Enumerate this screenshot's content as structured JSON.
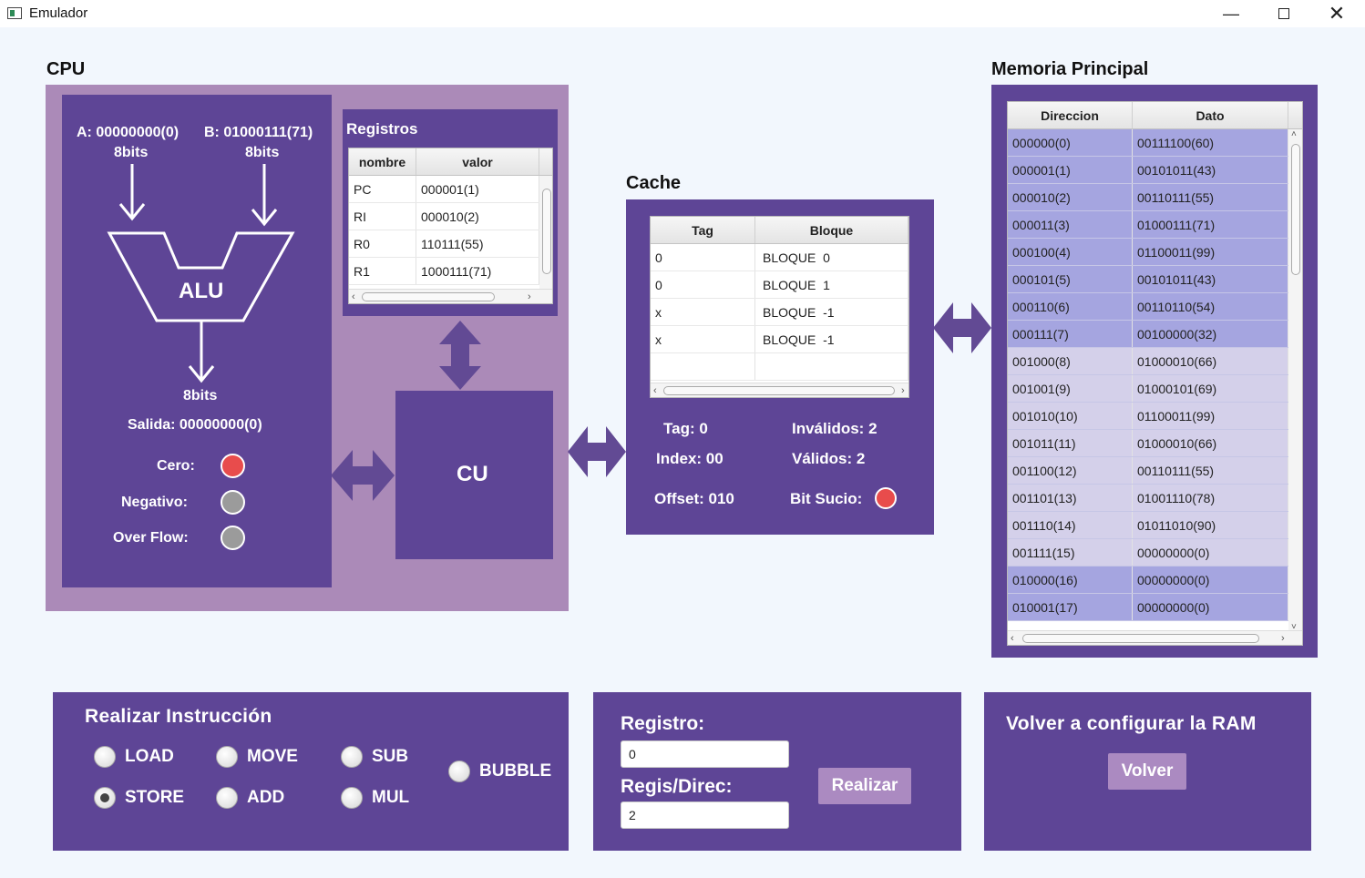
{
  "window": {
    "title": "Emulador"
  },
  "cpu": {
    "title": "CPU",
    "alu": {
      "a_label": "A: 00000000(0)",
      "a_bits": "8bits",
      "b_label": "B: 01000111(71)",
      "b_bits": "8bits",
      "alu_label": "ALU",
      "out_bits": "8bits",
      "salida": "Salida: 00000000(0)",
      "flags": [
        {
          "label": "Cero:",
          "color": "#e84c4c"
        },
        {
          "label": "Negativo:",
          "color": "#9b9b9b"
        },
        {
          "label": "Over Flow:",
          "color": "#9b9b9b"
        }
      ]
    },
    "registros": {
      "title": "Registros",
      "columns": [
        "nombre",
        "valor"
      ],
      "rows": [
        [
          "PC",
          "000001(1)"
        ],
        [
          "RI",
          "000010(2)"
        ],
        [
          "R0",
          "110111(55)"
        ],
        [
          "R1",
          "1000111(71)"
        ]
      ]
    },
    "cu_label": "CU"
  },
  "cache": {
    "title": "Cache",
    "columns": [
      "Tag",
      "Bloque"
    ],
    "rows": [
      [
        "0",
        "BLOQUE  0"
      ],
      [
        "0",
        "BLOQUE  1"
      ],
      [
        "x",
        "BLOQUE  -1"
      ],
      [
        "x",
        "BLOQUE  -1"
      ]
    ],
    "tag": "Tag: 0",
    "invalidos": "Inválidos: 2",
    "index": "Index: 00",
    "validos": "Válidos: 2",
    "offset": "Offset: 010",
    "bit_sucio": "Bit Sucio:",
    "bit_sucio_color": "#e84c4c"
  },
  "memoria": {
    "title": "Memoria Principal",
    "columns": [
      "Direccion",
      "Dato"
    ],
    "rows": [
      {
        "dir": "000000(0)",
        "dato": "00111100(60)",
        "hl": true
      },
      {
        "dir": "000001(1)",
        "dato": "00101011(43)",
        "hl": true
      },
      {
        "dir": "000010(2)",
        "dato": "00110111(55)",
        "hl": true
      },
      {
        "dir": "000011(3)",
        "dato": "01000111(71)",
        "hl": true
      },
      {
        "dir": "000100(4)",
        "dato": "01100011(99)",
        "hl": true
      },
      {
        "dir": "000101(5)",
        "dato": "00101011(43)",
        "hl": true
      },
      {
        "dir": "000110(6)",
        "dato": "00110110(54)",
        "hl": true
      },
      {
        "dir": "000111(7)",
        "dato": "00100000(32)",
        "hl": true
      },
      {
        "dir": "001000(8)",
        "dato": "01000010(66)",
        "hl": false
      },
      {
        "dir": "001001(9)",
        "dato": "01000101(69)",
        "hl": false
      },
      {
        "dir": "001010(10)",
        "dato": "01100011(99)",
        "hl": false
      },
      {
        "dir": "001011(11)",
        "dato": "01000010(66)",
        "hl": false
      },
      {
        "dir": "001100(12)",
        "dato": "00110111(55)",
        "hl": false
      },
      {
        "dir": "001101(13)",
        "dato": "01001110(78)",
        "hl": false
      },
      {
        "dir": "001110(14)",
        "dato": "01011010(90)",
        "hl": false
      },
      {
        "dir": "001111(15)",
        "dato": "00000000(0)",
        "hl": false
      },
      {
        "dir": "010000(16)",
        "dato": "00000000(0)",
        "hl": true
      },
      {
        "dir": "010001(17)",
        "dato": "00000000(0)",
        "hl": true
      }
    ],
    "colors": {
      "highlight": "#a5a5e0",
      "normal": "#d4d0ea"
    }
  },
  "instruccion": {
    "title": "Realizar Instrucción",
    "options": [
      {
        "label": "LOAD",
        "selected": false
      },
      {
        "label": "MOVE",
        "selected": false
      },
      {
        "label": "SUB",
        "selected": false
      },
      {
        "label": "BUBBLE",
        "selected": false
      },
      {
        "label": "STORE",
        "selected": true
      },
      {
        "label": "ADD",
        "selected": false
      },
      {
        "label": "MUL",
        "selected": false
      }
    ]
  },
  "operandos": {
    "registro_label": "Registro:",
    "registro_value": "0",
    "regis_direc_label": "Regis/Direc:",
    "regis_direc_value": "2",
    "realizar_label": "Realizar"
  },
  "config": {
    "title": "Volver a configurar la RAM",
    "button_label": "Volver"
  },
  "colors": {
    "panel": "#5e4596",
    "panel_light": "#ab8ab8",
    "button": "#ab8ac1"
  }
}
